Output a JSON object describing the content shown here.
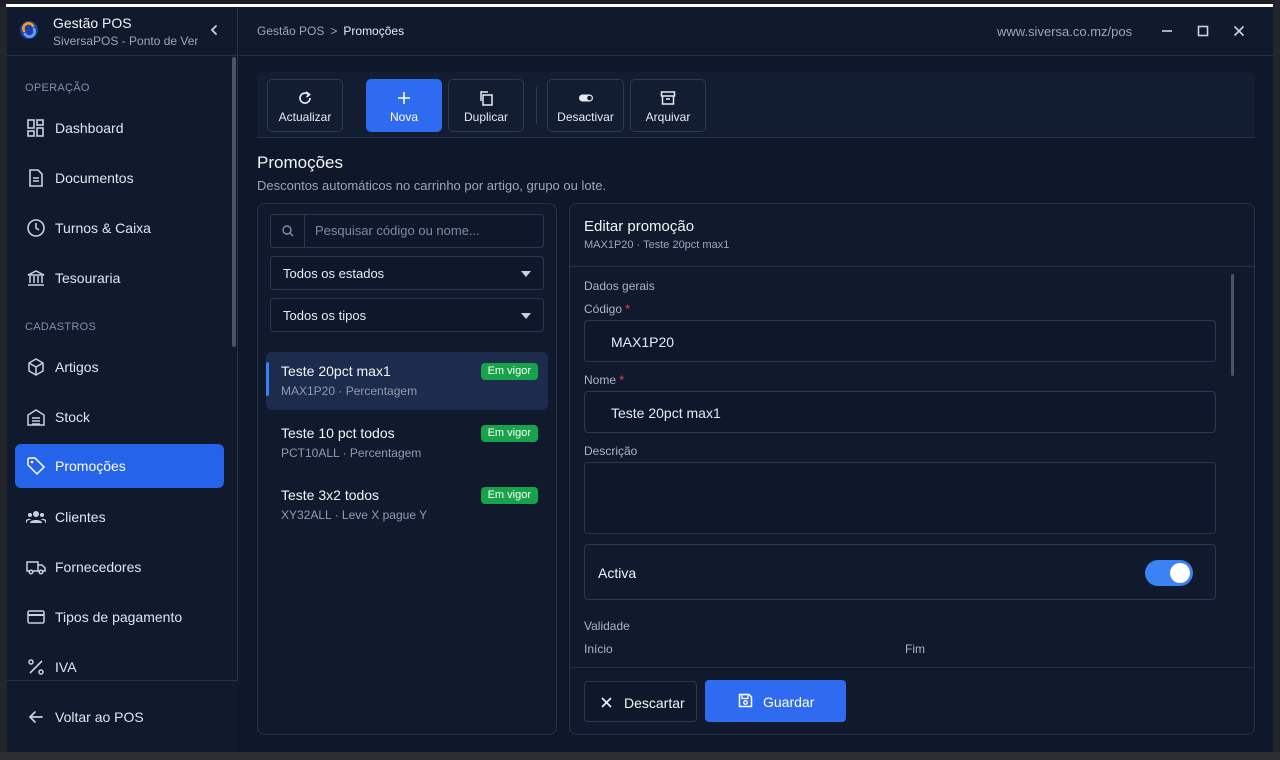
{
  "app": {
    "title": "Gestão POS",
    "subtitle": "SiversaPOS - Ponto de Venda"
  },
  "sidebar": {
    "sections": [
      {
        "label": "OPERAÇÃO"
      },
      {
        "label": "CADASTROS"
      }
    ],
    "items": [
      {
        "label": "Dashboard",
        "icon": "dashboard-icon"
      },
      {
        "label": "Documentos",
        "icon": "document-icon"
      },
      {
        "label": "Turnos & Caixa",
        "icon": "clock-icon"
      },
      {
        "label": "Tesouraria",
        "icon": "bank-icon"
      },
      {
        "label": "Artigos",
        "icon": "box-icon"
      },
      {
        "label": "Stock",
        "icon": "warehouse-icon"
      },
      {
        "label": "Promoções",
        "icon": "tag-icon"
      },
      {
        "label": "Clientes",
        "icon": "users-icon"
      },
      {
        "label": "Fornecedores",
        "icon": "truck-icon"
      },
      {
        "label": "Tipos de pagamento",
        "icon": "card-icon"
      },
      {
        "label": "IVA",
        "icon": "percent-icon"
      }
    ],
    "back_label": "Voltar ao POS"
  },
  "header": {
    "breadcrumb": [
      "Gestão POS",
      "Promoções"
    ],
    "url": "www.siversa.co.mz/pos"
  },
  "toolbar": {
    "buttons": [
      {
        "label": "Actualizar",
        "icon": "refresh-icon"
      },
      {
        "label": "Nova",
        "icon": "plus-icon"
      },
      {
        "label": "Duplicar",
        "icon": "copy-icon"
      },
      {
        "label": "Desactivar",
        "icon": "toggle-icon"
      },
      {
        "label": "Arquivar",
        "icon": "archive-icon"
      }
    ]
  },
  "page": {
    "title": "Promoções",
    "subtitle": "Descontos automáticos no carrinho por artigo, grupo ou lote."
  },
  "list": {
    "search_placeholder": "Pesquisar código ou nome...",
    "status_filter": "Todos os estados",
    "type_filter": "Todos os tipos",
    "items": [
      {
        "name": "Teste 20pct max1",
        "meta": "MAX1P20 · Percentagem",
        "badge": "Em vigor"
      },
      {
        "name": "Teste 10 pct todos",
        "meta": "PCT10ALL · Percentagem",
        "badge": "Em vigor"
      },
      {
        "name": "Teste 3x2 todos",
        "meta": "XY32ALL · Leve X pague Y",
        "badge": "Em vigor"
      }
    ]
  },
  "editor": {
    "title": "Editar promoção",
    "subtitle": "MAX1P20 · Teste 20pct max1",
    "general_label": "Dados gerais",
    "code_label": "Código",
    "code_value": "MAX1P20",
    "name_label": "Nome",
    "name_value": "Teste 20pct max1",
    "description_label": "Descrição",
    "description_value": "",
    "required_mark": "*",
    "active_label": "Activa",
    "active": true,
    "validity_label": "Validade",
    "start_label": "Início",
    "end_label": "Fim",
    "discard_label": "Descartar",
    "save_label": "Guardar"
  },
  "colors": {
    "accent": "#2f6bf0",
    "badge": "#16a34a",
    "background": "#0f172a"
  }
}
